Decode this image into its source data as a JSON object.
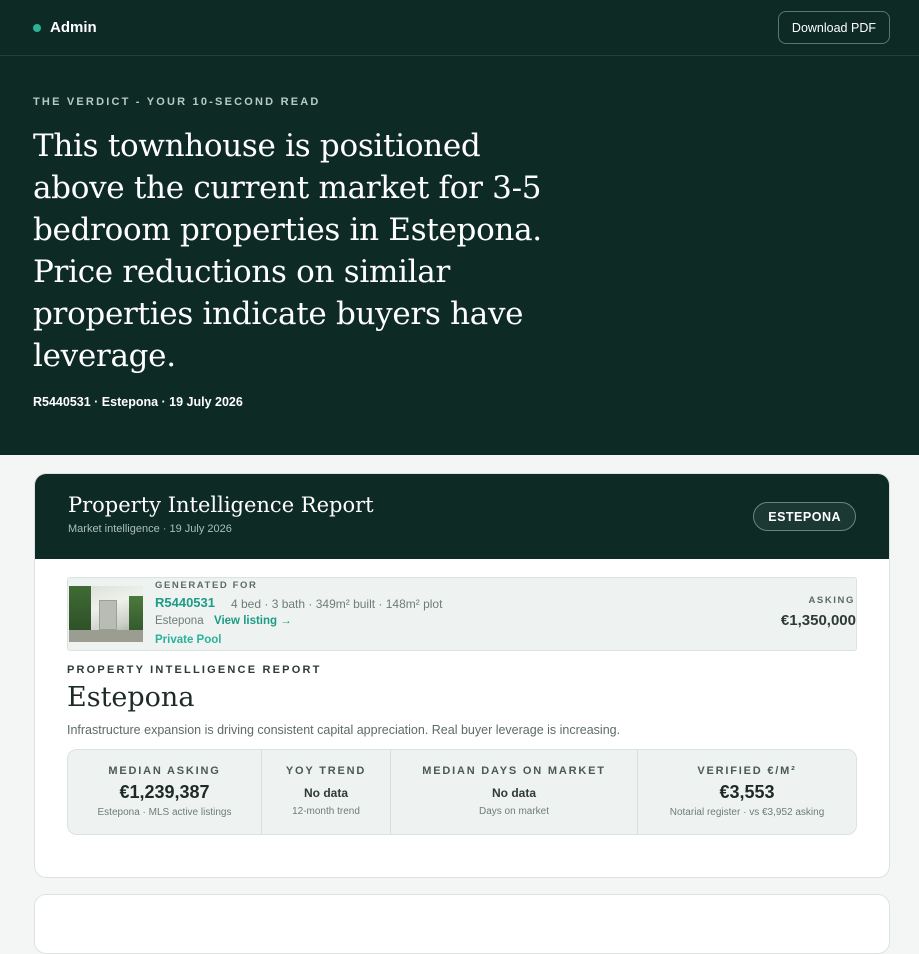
{
  "app": {
    "brand": "Admin",
    "download_label": "Download PDF"
  },
  "hero": {
    "eyebrow": "THE VERDICT - YOUR 10-SECOND READ",
    "headline": "This townhouse is positioned above the current market for 3-5 bedroom properties in Estepona. Price reductions on similar properties indicate buyers have leverage.",
    "meta": "R5440531 · Estepona · 19 July 2026"
  },
  "report": {
    "title": "Property Intelligence Report",
    "subtitle": "Market intelligence · 19 July 2026",
    "location_pill": "ESTEPONA"
  },
  "generated": {
    "label": "GENERATED FOR",
    "ref": "R5440531",
    "specs": "4 bed · 3 bath · 349m² built · 148m² plot",
    "location": "Estepona",
    "view_link": "View listing →",
    "feature": "Private Pool",
    "asking_label": "ASKING",
    "asking_value": "€1,350,000"
  },
  "intel": {
    "label": "PROPERTY INTELLIGENCE REPORT",
    "city": "Estepona",
    "description": "Infrastructure expansion is driving consistent capital appreciation. Real buyer leverage is increasing."
  },
  "stats": [
    {
      "label": "MEDIAN ASKING",
      "value": "€1,239,387",
      "note": "Estepona · MLS active listings"
    },
    {
      "label": "YOY TREND",
      "value": "No data",
      "note": "12-month trend"
    },
    {
      "label": "MEDIAN DAYS ON MARKET",
      "value": "No data",
      "note": "Days on market"
    },
    {
      "label": "VERIFIED €/M²",
      "value": "€3,553",
      "note": "Notarial register · vs €3,952 asking"
    }
  ],
  "colors": {
    "dark": "#0e2a25",
    "accent": "#2bb39a",
    "link": "#1c9c86"
  }
}
